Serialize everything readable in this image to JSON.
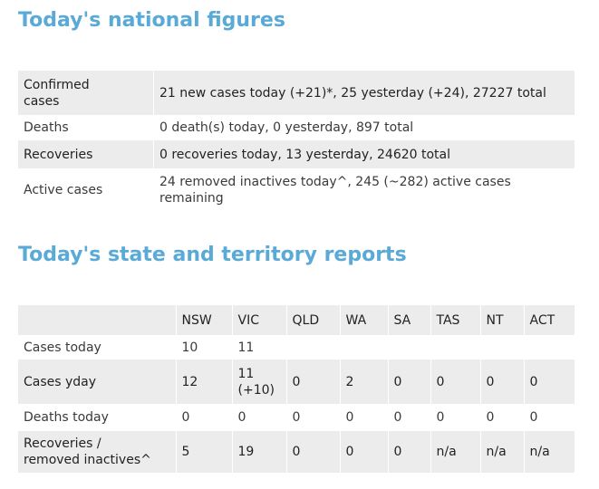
{
  "national": {
    "heading": "Today's national figures",
    "rows": [
      {
        "label_line1": "Confirmed",
        "label_line2": "cases",
        "value": "21 new cases today (+21)*, 25 yesterday (+24), 27227 total"
      },
      {
        "label": "Deaths",
        "value": "0 death(s) today, 0 yesterday, 897 total"
      },
      {
        "label": "Recoveries",
        "value": "0 recoveries today, 13 yesterday, 24620 total"
      },
      {
        "label": "Active cases",
        "value_line1": "24 removed inactives today^, 245 (~282) active cases",
        "value_line2": "remaining"
      }
    ]
  },
  "states": {
    "heading": "Today's state and territory reports",
    "columns": [
      "NSW",
      "VIC",
      "QLD",
      "WA",
      "SA",
      "TAS",
      "NT",
      "ACT"
    ],
    "rows": [
      {
        "label": "Cases today",
        "cells": [
          "10",
          "11",
          "",
          "",
          "",
          "",
          "",
          ""
        ]
      },
      {
        "label": "Cases yday",
        "cells": [
          "12",
          "",
          "0",
          "2",
          "0",
          "0",
          "0",
          "0"
        ],
        "vic_line1": "11",
        "vic_line2": "(+10)"
      },
      {
        "label": "Deaths today",
        "cells": [
          "0",
          "0",
          "0",
          "0",
          "0",
          "0",
          "0",
          "0"
        ]
      },
      {
        "label_line1": "Recoveries /",
        "label_line2": "removed inactives^",
        "cells": [
          "5",
          "19",
          "0",
          "0",
          "0",
          "n/a",
          "n/a",
          "n/a"
        ]
      }
    ]
  },
  "colors": {
    "heading": "#5aaad7",
    "row_shade": "#ececec"
  }
}
